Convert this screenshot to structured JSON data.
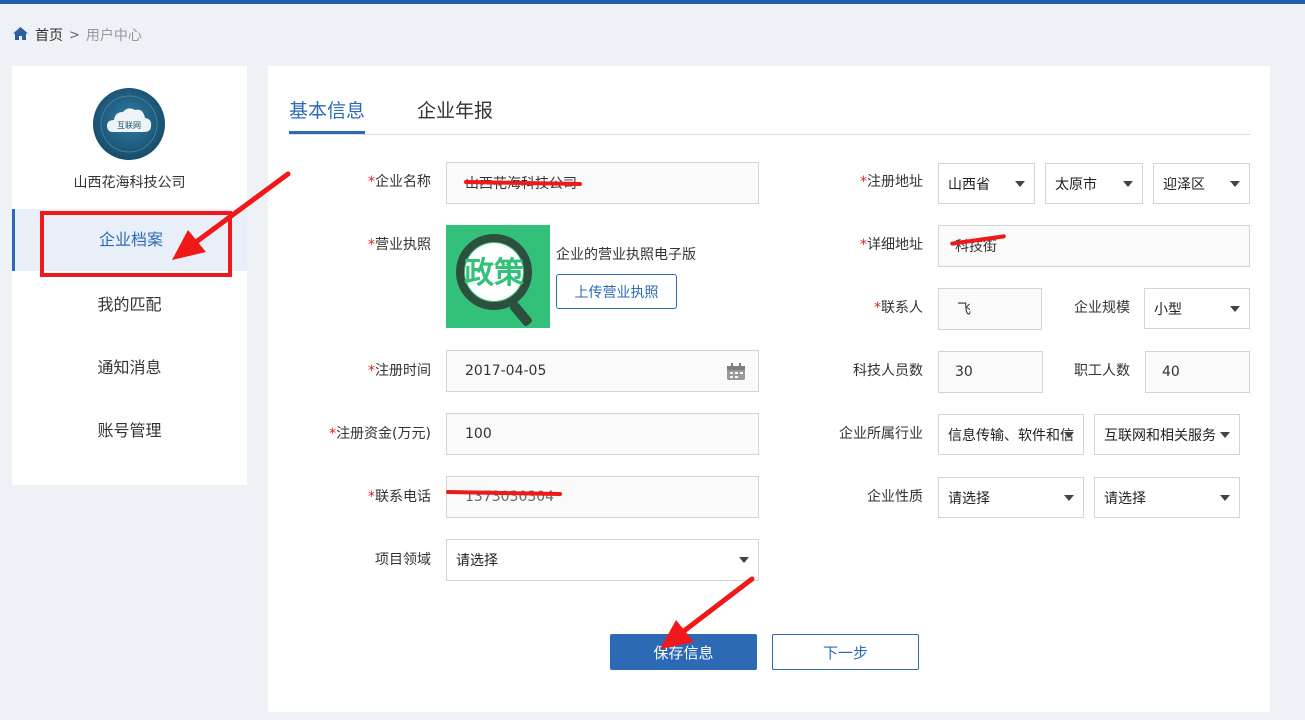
{
  "breadcrumb": {
    "home": "首页",
    "separator": ">",
    "current": "用户中心"
  },
  "sidebar": {
    "company_name": "山西花海科技公司",
    "avatar_text": "互联网",
    "items": [
      {
        "label": "企业档案",
        "active": true
      },
      {
        "label": "我的匹配",
        "active": false
      },
      {
        "label": "通知消息",
        "active": false
      },
      {
        "label": "账号管理",
        "active": false
      }
    ]
  },
  "tabs": [
    {
      "label": "基本信息",
      "active": true
    },
    {
      "label": "企业年报",
      "active": false
    }
  ],
  "form": {
    "company_name": {
      "label": "企业名称",
      "value": "山西花海科技公司",
      "required": true
    },
    "license": {
      "label": "营业执照",
      "desc": "企业的营业执照电子版",
      "upload_label": "上传营业执照",
      "image_text": "政策",
      "required": true
    },
    "reg_date": {
      "label": "注册时间",
      "value": "2017-04-05",
      "required": true
    },
    "reg_capital": {
      "label": "注册资金(万元)",
      "value": "100",
      "required": true
    },
    "phone": {
      "label": "联系电话",
      "value": "1373030304",
      "required": true
    },
    "project_field": {
      "label": "项目领域",
      "value": "请选择"
    },
    "reg_address": {
      "label": "注册地址",
      "province": "山西省",
      "city": "太原市",
      "district": "迎泽区",
      "required": true
    },
    "detail_address": {
      "label": "详细地址",
      "value": "科技街",
      "required": true
    },
    "contact": {
      "label": "联系人",
      "value": "飞",
      "required": true
    },
    "scale": {
      "label": "企业规模",
      "value": "小型"
    },
    "tech_staff": {
      "label": "科技人员数",
      "value": "30"
    },
    "staff": {
      "label": "职工人数",
      "value": "40"
    },
    "industry": {
      "label": "企业所属行业",
      "value1": "信息传输、软件和信",
      "value2": "互联网和相关服务"
    },
    "nature": {
      "label": "企业性质",
      "value1": "请选择",
      "value2": "请选择"
    }
  },
  "buttons": {
    "save": "保存信息",
    "next": "下一步"
  },
  "colors": {
    "primary": "#2d6ab6",
    "required": "#e02020",
    "annotation": "#f01818",
    "license_bg": "#33c079"
  },
  "icons": [
    "home-icon",
    "calendar-icon",
    "chevron-down-icon"
  ]
}
